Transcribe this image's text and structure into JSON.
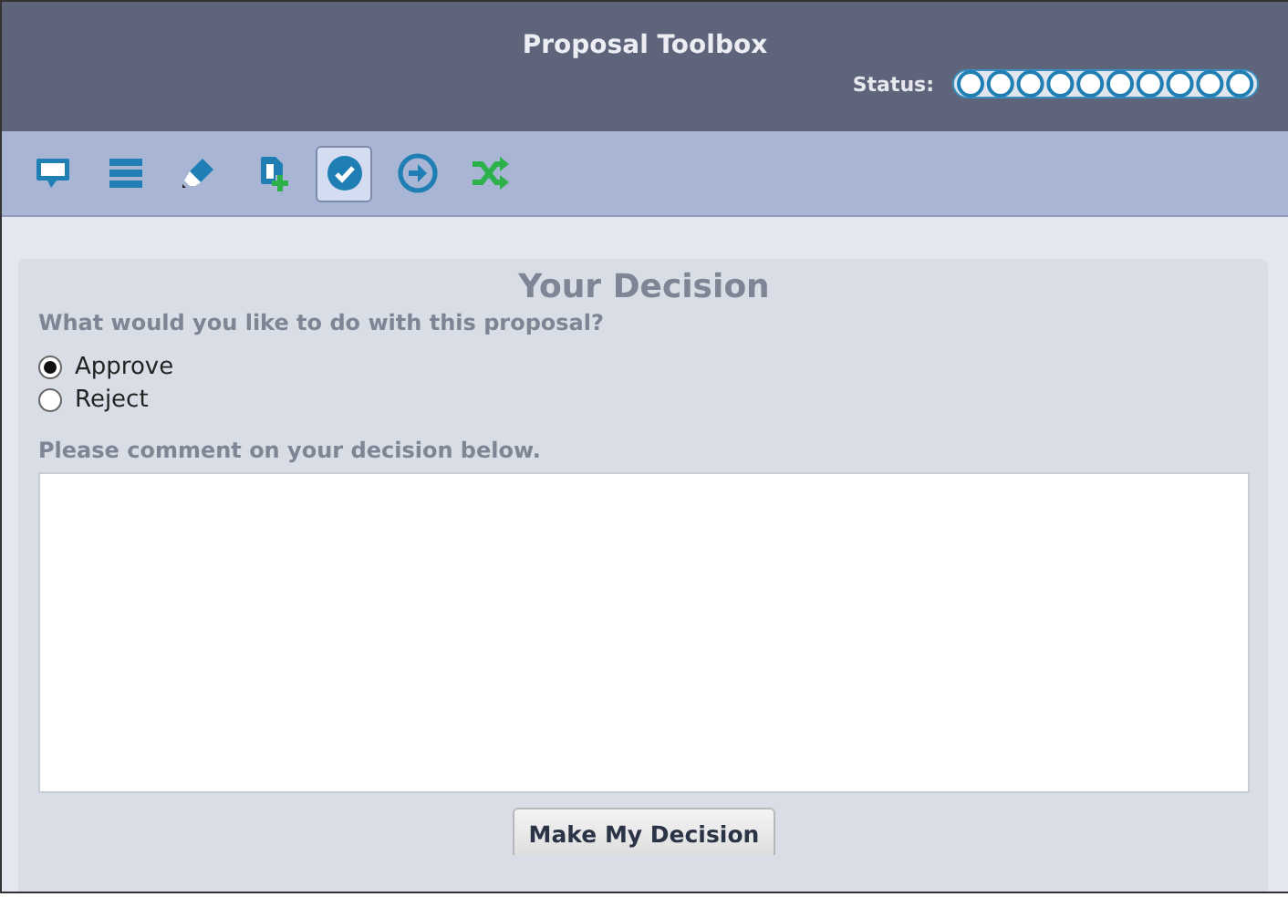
{
  "window": {
    "title": "Proposal Toolbox"
  },
  "status": {
    "label": "Status:"
  },
  "toolbar": [
    {
      "kind": "comment",
      "selected": false
    },
    {
      "kind": "list",
      "selected": false
    },
    {
      "kind": "edit",
      "selected": false
    },
    {
      "kind": "add",
      "selected": false
    },
    {
      "kind": "check",
      "selected": true
    },
    {
      "kind": "forward",
      "selected": false
    },
    {
      "kind": "shuffle",
      "selected": false
    }
  ],
  "panel": {
    "title": "Your Decision",
    "question": "What would you like to do with this proposal?",
    "options": [
      {
        "label": "Approve",
        "selected": true
      },
      {
        "label": "Reject",
        "selected": false
      }
    ],
    "comment_label": "Please comment on your decision below.",
    "submit": "Make My Decision"
  }
}
